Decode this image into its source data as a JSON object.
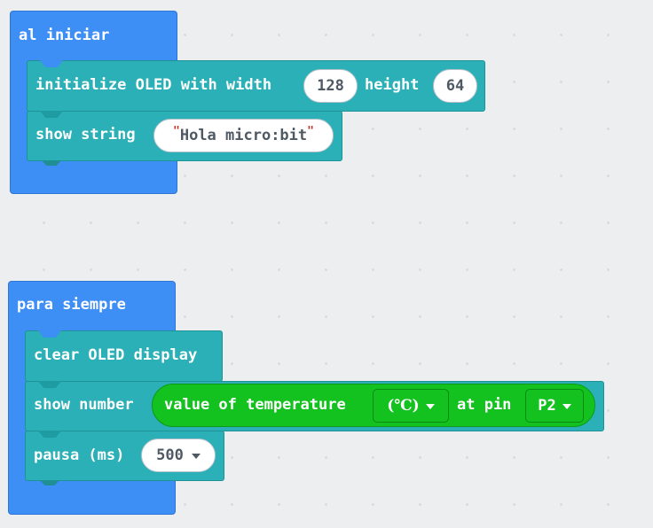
{
  "on_start": {
    "label": "al iniciar",
    "init_oled": {
      "label_a": "initialize OLED with width",
      "width": "128",
      "label_b": "height",
      "height": "64"
    },
    "show_string": {
      "label": "show string",
      "value": "Hola micro:bit"
    }
  },
  "forever": {
    "label": "para siempre",
    "clear_oled": {
      "label": "clear OLED display"
    },
    "show_number": {
      "label": "show number",
      "reporter_label": "value of temperature",
      "unit": "(℃)",
      "at_pin_label": "at pin",
      "pin": "P2"
    },
    "pause": {
      "label": "pausa (ms)",
      "value": "500"
    }
  },
  "colors": {
    "event_block": "#3d8ef5",
    "oled_block": "#2ab0b6",
    "sensor_reporter": "#13c11f",
    "workspace": "#eceef0"
  }
}
